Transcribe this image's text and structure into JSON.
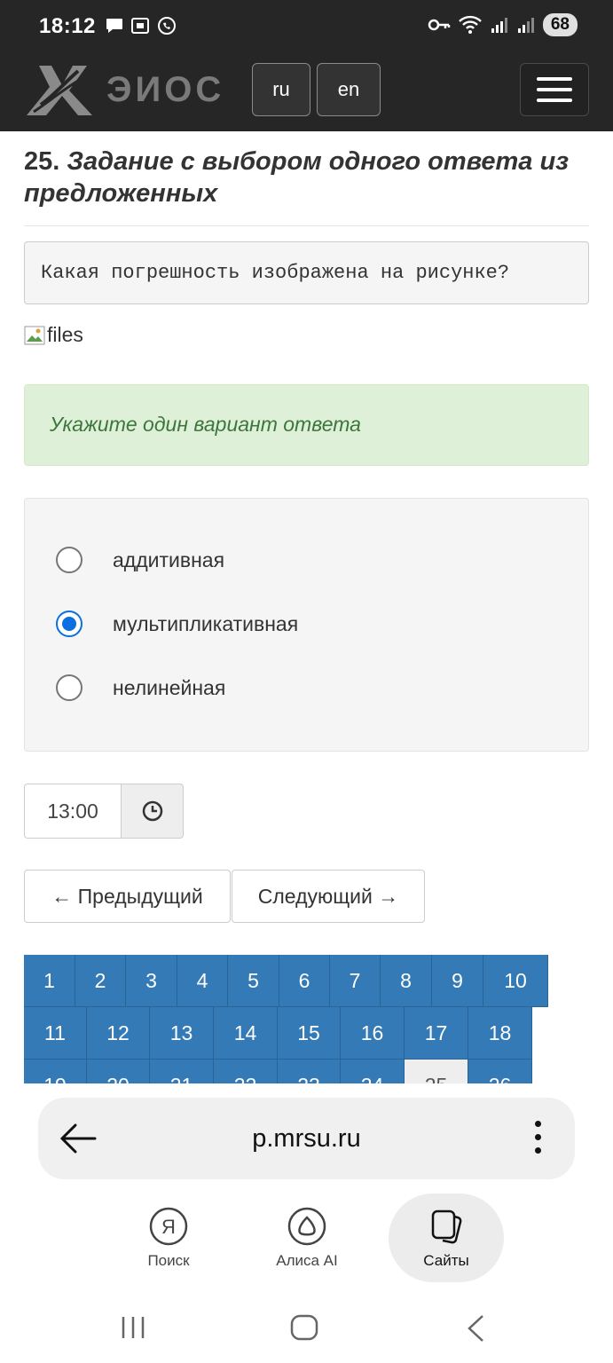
{
  "status_bar": {
    "time": "18:12",
    "left_icons": [
      "message-icon",
      "screenshot-icon",
      "whatsapp-icon"
    ],
    "right_icons": [
      "key-icon",
      "wifi-icon",
      "signal-icon",
      "signal-icon"
    ],
    "battery": "68"
  },
  "header": {
    "logo_text": "ЭИОС",
    "lang_ru": "ru",
    "lang_en": "en",
    "menu_icon": "hamburger-icon"
  },
  "task": {
    "number": "25.",
    "title": "Задание с выбором одного ответа из предложенных",
    "question": "Какая погрешность изображена на рисунке?",
    "image_alt": "files",
    "instruction": "Укажите один вариант ответа",
    "options": [
      {
        "label": "аддитивная",
        "checked": false
      },
      {
        "label": "мультипликативная",
        "checked": true
      },
      {
        "label": "нелинейная",
        "checked": false
      }
    ]
  },
  "timer": {
    "value": "13:00",
    "icon": "clock-icon"
  },
  "navigation": {
    "prev": "← Предыдущий",
    "next": "Следующий →"
  },
  "pager": {
    "row1": [
      "1",
      "2",
      "3",
      "4",
      "5",
      "6",
      "7",
      "8",
      "9",
      "10"
    ],
    "row2": [
      "11",
      "12",
      "13",
      "14",
      "15",
      "16",
      "17",
      "18"
    ],
    "row3": [
      "19",
      "20",
      "21",
      "22",
      "23",
      "24",
      "25",
      "26"
    ],
    "current": "25"
  },
  "browser": {
    "url": "p.mrsu.ru",
    "tabs": [
      {
        "label": "Поиск",
        "icon": "yandex-icon"
      },
      {
        "label": "Алиса AI",
        "icon": "alice-icon"
      },
      {
        "label": "Сайты",
        "icon": "sites-icon"
      }
    ]
  },
  "colors": {
    "header_bg": "#262626",
    "pager_blue": "#337ab7",
    "alert_green_bg": "#dff0d8",
    "alert_green_text": "#3c763d",
    "radio_accent": "#0b6fe0"
  }
}
